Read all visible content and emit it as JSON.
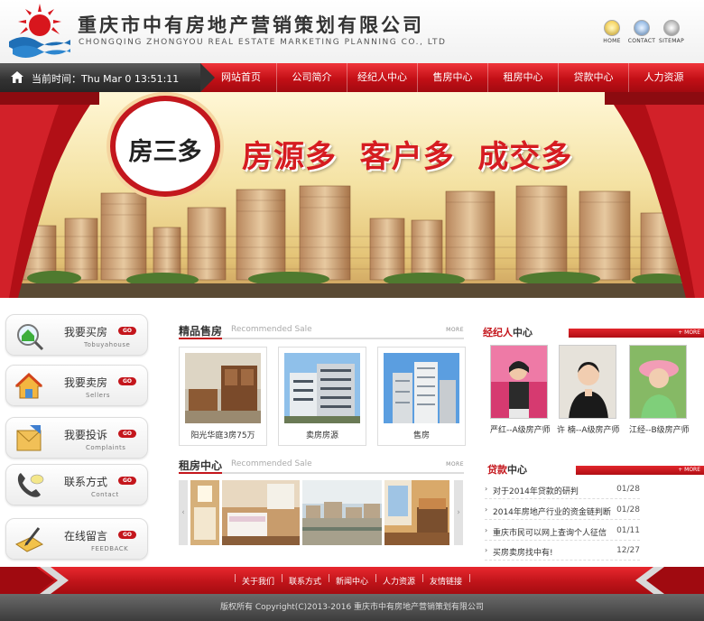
{
  "header": {
    "title_cn": "重庆市中有房地产营销策划有限公司",
    "title_en": "CHONGQING ZHONGYOU REAL ESTATE MARKETING PLANNING CO., LTD",
    "icons": [
      {
        "label": "HOME",
        "name": "home-icon"
      },
      {
        "label": "CONTACT",
        "name": "mail-icon"
      },
      {
        "label": "SITEMAP",
        "name": "sitemap-icon"
      }
    ]
  },
  "nav": {
    "time_text": "当前时间：Thu Mar 0 13:51:11",
    "items": [
      "网站首页",
      "公司简介",
      "经纪人中心",
      "售房中心",
      "租房中心",
      "贷款中心",
      "人力资源"
    ]
  },
  "banner": {
    "badge": "房三多",
    "slogan": "房源多  客户多  成交多"
  },
  "sidebar": {
    "buttons": [
      {
        "cn": "我要买房",
        "en": "Tobuyahouse",
        "go": "GO",
        "icon": "magnifier-house-icon"
      },
      {
        "cn": "我要卖房",
        "en": "Sellers",
        "go": "GO",
        "icon": "house-icon"
      },
      {
        "cn": "我要投诉",
        "en": "Complaints",
        "go": "GO",
        "icon": "envelope-icon"
      },
      {
        "cn": "联系方式",
        "en": "Contact",
        "go": "GO",
        "icon": "phone-icon"
      },
      {
        "cn": "在线留言",
        "en": "FEEDBACK",
        "go": "GO",
        "icon": "notepad-icon"
      }
    ]
  },
  "sale": {
    "title": "精品售房",
    "subtitle": "Recommended Sale",
    "more": "MORE",
    "items": [
      {
        "caption": "阳光华庭3房75万"
      },
      {
        "caption": "卖房房源"
      },
      {
        "caption": "售房"
      }
    ]
  },
  "rent": {
    "title": "租房中心",
    "subtitle": "Recommended Sale",
    "more": "MORE"
  },
  "agents": {
    "title_red": "经纪人",
    "title_rest": "中心",
    "more": "+ MORE",
    "items": [
      {
        "caption": "严红--A级房产师"
      },
      {
        "caption": "许  楠--A级房产师"
      },
      {
        "caption": "江经--B级房产师"
      }
    ]
  },
  "loans": {
    "title_red": "贷款",
    "title_rest": "中心",
    "more": "+ MORE",
    "items": [
      {
        "title": "对于2014年贷款的研判",
        "date": "01/28"
      },
      {
        "title": "2014年房地产行业的资金链判断",
        "date": "01/28"
      },
      {
        "title": "重庆市民可以网上查询个人征信",
        "date": "01/11"
      },
      {
        "title": "买房卖房找中有!",
        "date": "12/27"
      }
    ]
  },
  "footer": {
    "links": [
      "关于我们",
      "联系方式",
      "新闻中心",
      "人力资源",
      "友情链接"
    ],
    "copyright": "版权所有 Copyright(C)2013-2016 重庆市中有房地产营销策划有限公司"
  }
}
